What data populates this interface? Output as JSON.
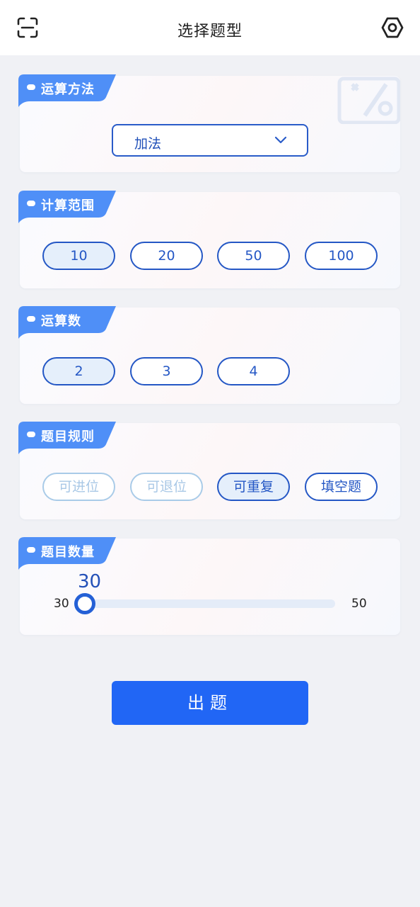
{
  "header": {
    "title": "选择题型",
    "left_icon": "scan-icon",
    "right_icon": "settings-hexagon-icon"
  },
  "sections": {
    "operation": {
      "label": "运算方法",
      "selected": "加法"
    },
    "range": {
      "label": "计算范围",
      "options": [
        {
          "label": "10",
          "state": "selected"
        },
        {
          "label": "20",
          "state": "normal"
        },
        {
          "label": "50",
          "state": "normal"
        },
        {
          "label": "100",
          "state": "normal"
        }
      ]
    },
    "operand_count": {
      "label": "运算数",
      "options": [
        {
          "label": "2",
          "state": "selected"
        },
        {
          "label": "3",
          "state": "normal"
        },
        {
          "label": "4",
          "state": "normal"
        }
      ]
    },
    "rules": {
      "label": "题目规则",
      "options": [
        {
          "label": "可进位",
          "state": "disabled"
        },
        {
          "label": "可退位",
          "state": "disabled"
        },
        {
          "label": "可重复",
          "state": "selected"
        },
        {
          "label": "填空题",
          "state": "normal"
        }
      ]
    },
    "quantity": {
      "label": "题目数量",
      "current": "30",
      "min": "30",
      "max": "50",
      "level": 0
    }
  },
  "submit_label": "出题",
  "colors": {
    "primary": "#2166f5",
    "outline": "#2457c5",
    "selected_fill": "#e5effb",
    "disabled": "#a9cbe8",
    "background": "#f0f1f5"
  }
}
